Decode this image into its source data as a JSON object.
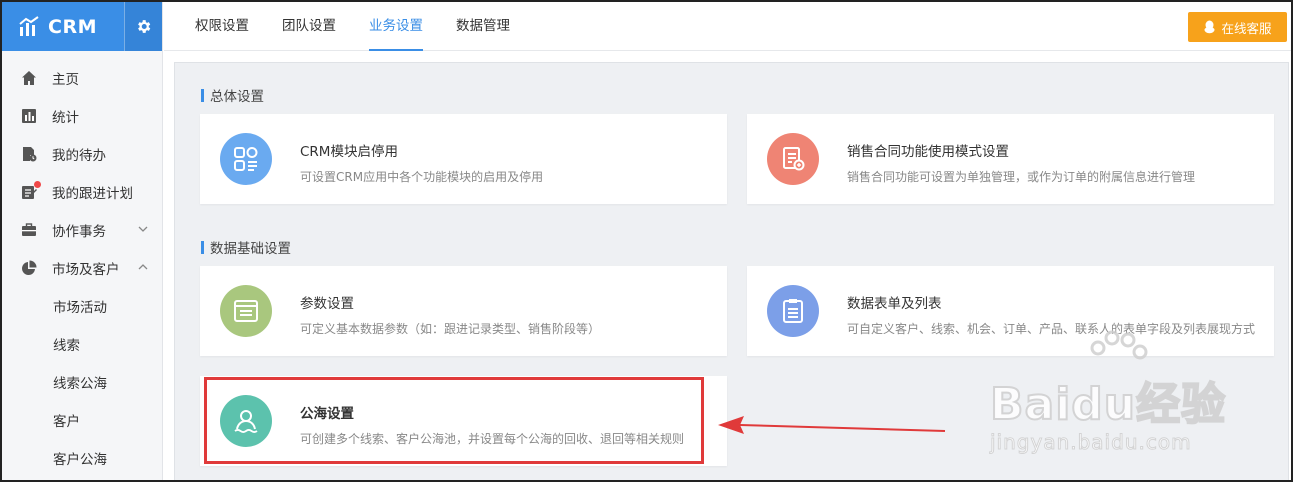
{
  "brand": {
    "name": "CRM"
  },
  "sidebar": {
    "items": [
      {
        "label": "主页"
      },
      {
        "label": "统计"
      },
      {
        "label": "我的待办"
      },
      {
        "label": "我的跟进计划"
      },
      {
        "label": "协作事务"
      },
      {
        "label": "市场及客户"
      }
    ],
    "subitems": [
      {
        "label": "市场活动"
      },
      {
        "label": "线索"
      },
      {
        "label": "线索公海"
      },
      {
        "label": "客户"
      },
      {
        "label": "客户公海"
      }
    ]
  },
  "tabs": [
    {
      "label": "权限设置"
    },
    {
      "label": "团队设置"
    },
    {
      "label": "业务设置"
    },
    {
      "label": "数据管理"
    }
  ],
  "service_button": {
    "label": "在线客服"
  },
  "sections": [
    {
      "title": "总体设置"
    },
    {
      "title": "数据基础设置"
    }
  ],
  "cards": [
    {
      "title": "CRM模块启停用",
      "desc": "可设置CRM应用中各个功能模块的启用及停用",
      "color": "#6aaaf0"
    },
    {
      "title": "销售合同功能使用模式设置",
      "desc": "销售合同功能可设置为单独管理，或作为订单的附属信息进行管理",
      "color": "#ef8474"
    },
    {
      "title": "参数设置",
      "desc": "可定义基本数据参数（如：跟进记录类型、销售阶段等）",
      "color": "#a9c77e"
    },
    {
      "title": "数据表单及列表",
      "desc": "可自定义客户、线索、机会、订单、产品、联系人的表单字段及列表展现方式",
      "color": "#7c9fe8"
    },
    {
      "title": "公海设置",
      "desc": "可创建多个线索、客户公海池，并设置每个公海的回收、退回等相关规则",
      "color": "#5cc2ad"
    }
  ],
  "watermark": {
    "main": "Baidu经验",
    "sub": "jingyan.baidu.com"
  },
  "colors": {
    "accent": "#3a8ee6",
    "service": "#f7a21b",
    "highlight": "#e03a3a"
  }
}
